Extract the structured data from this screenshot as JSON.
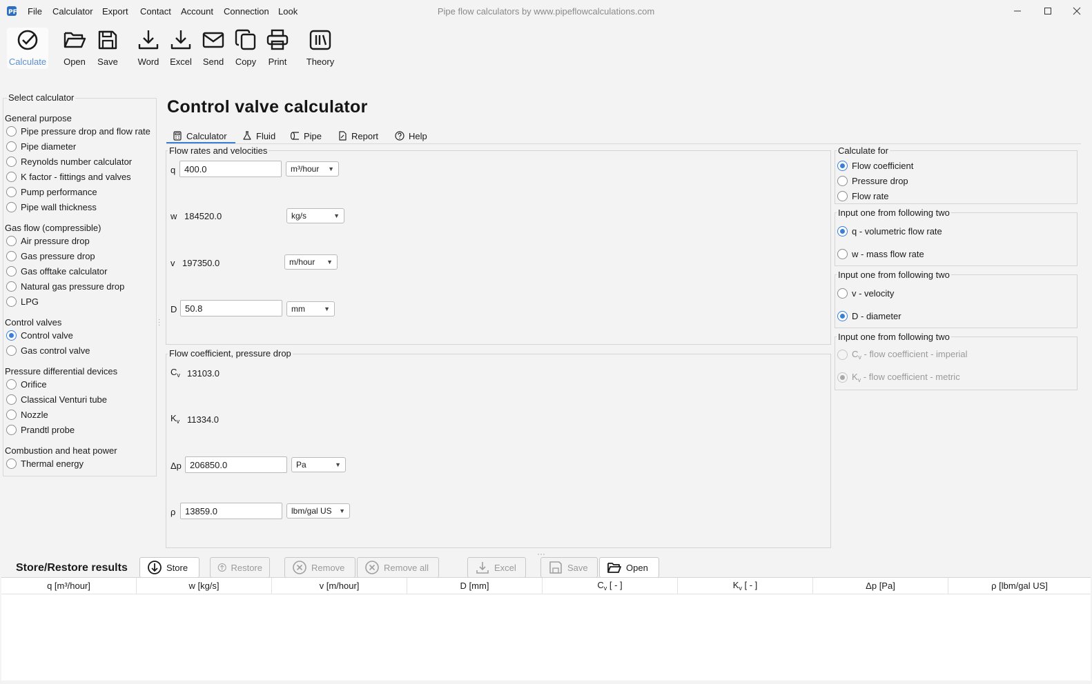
{
  "window": {
    "title": "Pipe flow calculators by www.pipeflowcalculations.com",
    "menu": [
      "File",
      "Calculator",
      "Export",
      "Contact",
      "Account",
      "Connection",
      "Look"
    ]
  },
  "toolbar": {
    "calculate": "Calculate",
    "open": "Open",
    "save": "Save",
    "word": "Word",
    "excel": "Excel",
    "send": "Send",
    "copy": "Copy",
    "print": "Print",
    "theory": "Theory"
  },
  "sidebar": {
    "label": "Select calculator",
    "groups": [
      {
        "title": "General purpose",
        "items": [
          "Pipe pressure drop and flow rate",
          "Pipe diameter",
          "Reynolds number calculator",
          "K factor - fittings and valves",
          "Pump performance",
          "Pipe wall thickness"
        ]
      },
      {
        "title": "Gas flow (compressible)",
        "items": [
          "Air pressure drop",
          "Gas pressure drop",
          "Gas offtake calculator",
          "Natural gas pressure drop",
          "LPG"
        ]
      },
      {
        "title": "Control valves",
        "items": [
          "Control valve",
          "Gas control valve"
        ]
      },
      {
        "title": "Pressure differential devices",
        "items": [
          "Orifice",
          "Classical Venturi tube",
          "Nozzle",
          "Prandtl probe"
        ]
      },
      {
        "title": "Combustion and heat power",
        "items": [
          "Thermal energy"
        ]
      }
    ],
    "selected": "Control valve"
  },
  "main": {
    "title": "Control valve calculator",
    "tabs": [
      "Calculator",
      "Fluid",
      "Pipe",
      "Report",
      "Help"
    ],
    "active_tab": "Calculator"
  },
  "flow": {
    "title": "Flow rates and velocities",
    "q": {
      "symbol": "q",
      "value": "400.0",
      "unit": "m³/hour"
    },
    "w": {
      "symbol": "w",
      "value": "184520.0",
      "unit": "kg/s"
    },
    "v": {
      "symbol": "v",
      "value": "197350.0",
      "unit": "m/hour"
    },
    "D": {
      "symbol": "D",
      "value": "50.8",
      "unit": "mm"
    }
  },
  "coef": {
    "title": "Flow coefficient, pressure drop",
    "cv": {
      "symbol": "C",
      "sub": "v",
      "value": "13103.0"
    },
    "kv": {
      "symbol": "K",
      "sub": "v",
      "value": "11334.0"
    },
    "dp": {
      "symbol": "Δp",
      "value": "206850.0",
      "unit": "Pa"
    },
    "rho": {
      "symbol": "ρ",
      "value": "13859.0",
      "unit": "lbm/gal US"
    }
  },
  "calc_for": {
    "title": "Calculate for",
    "options": [
      "Flow coefficient",
      "Pressure drop",
      "Flow rate"
    ],
    "selected": "Flow coefficient"
  },
  "input1": {
    "title": "Input one from following two",
    "opt_a": "q - volumetric flow rate",
    "opt_b": "w - mass flow rate",
    "selected": "q - volumetric flow rate"
  },
  "input2": {
    "title": "Input one from following two",
    "opt_a": "v - velocity",
    "opt_b": "D - diameter",
    "selected": "D - diameter"
  },
  "input3": {
    "title": "Input one from following two",
    "opt_a": "C",
    "opt_a_sub": "v",
    "opt_a_rest": " - flow coefficient - imperial",
    "opt_b": "K",
    "opt_b_sub": "v",
    "opt_b_rest": " - flow coefficient - metric",
    "selected": "K"
  },
  "store": {
    "title": "Store/Restore results",
    "buttons": {
      "store": "Store",
      "restore": "Restore",
      "remove": "Remove",
      "remove_all": "Remove all",
      "excel": "Excel",
      "save": "Save",
      "open": "Open"
    },
    "columns": [
      {
        "label": "q [m³/hour]"
      },
      {
        "label": "w [kg/s]"
      },
      {
        "label": "v [m/hour]"
      },
      {
        "label": "D [mm]"
      },
      {
        "label": "C",
        "sub": "v",
        "rest": " [ - ]"
      },
      {
        "label": "K",
        "sub": "v",
        "rest": " [ - ]"
      },
      {
        "label": "Δp [Pa]"
      },
      {
        "label": "ρ [lbm/gal US]"
      }
    ]
  },
  "colors": {
    "accent": "#3a7fd6",
    "background": "#f3f3f3"
  }
}
